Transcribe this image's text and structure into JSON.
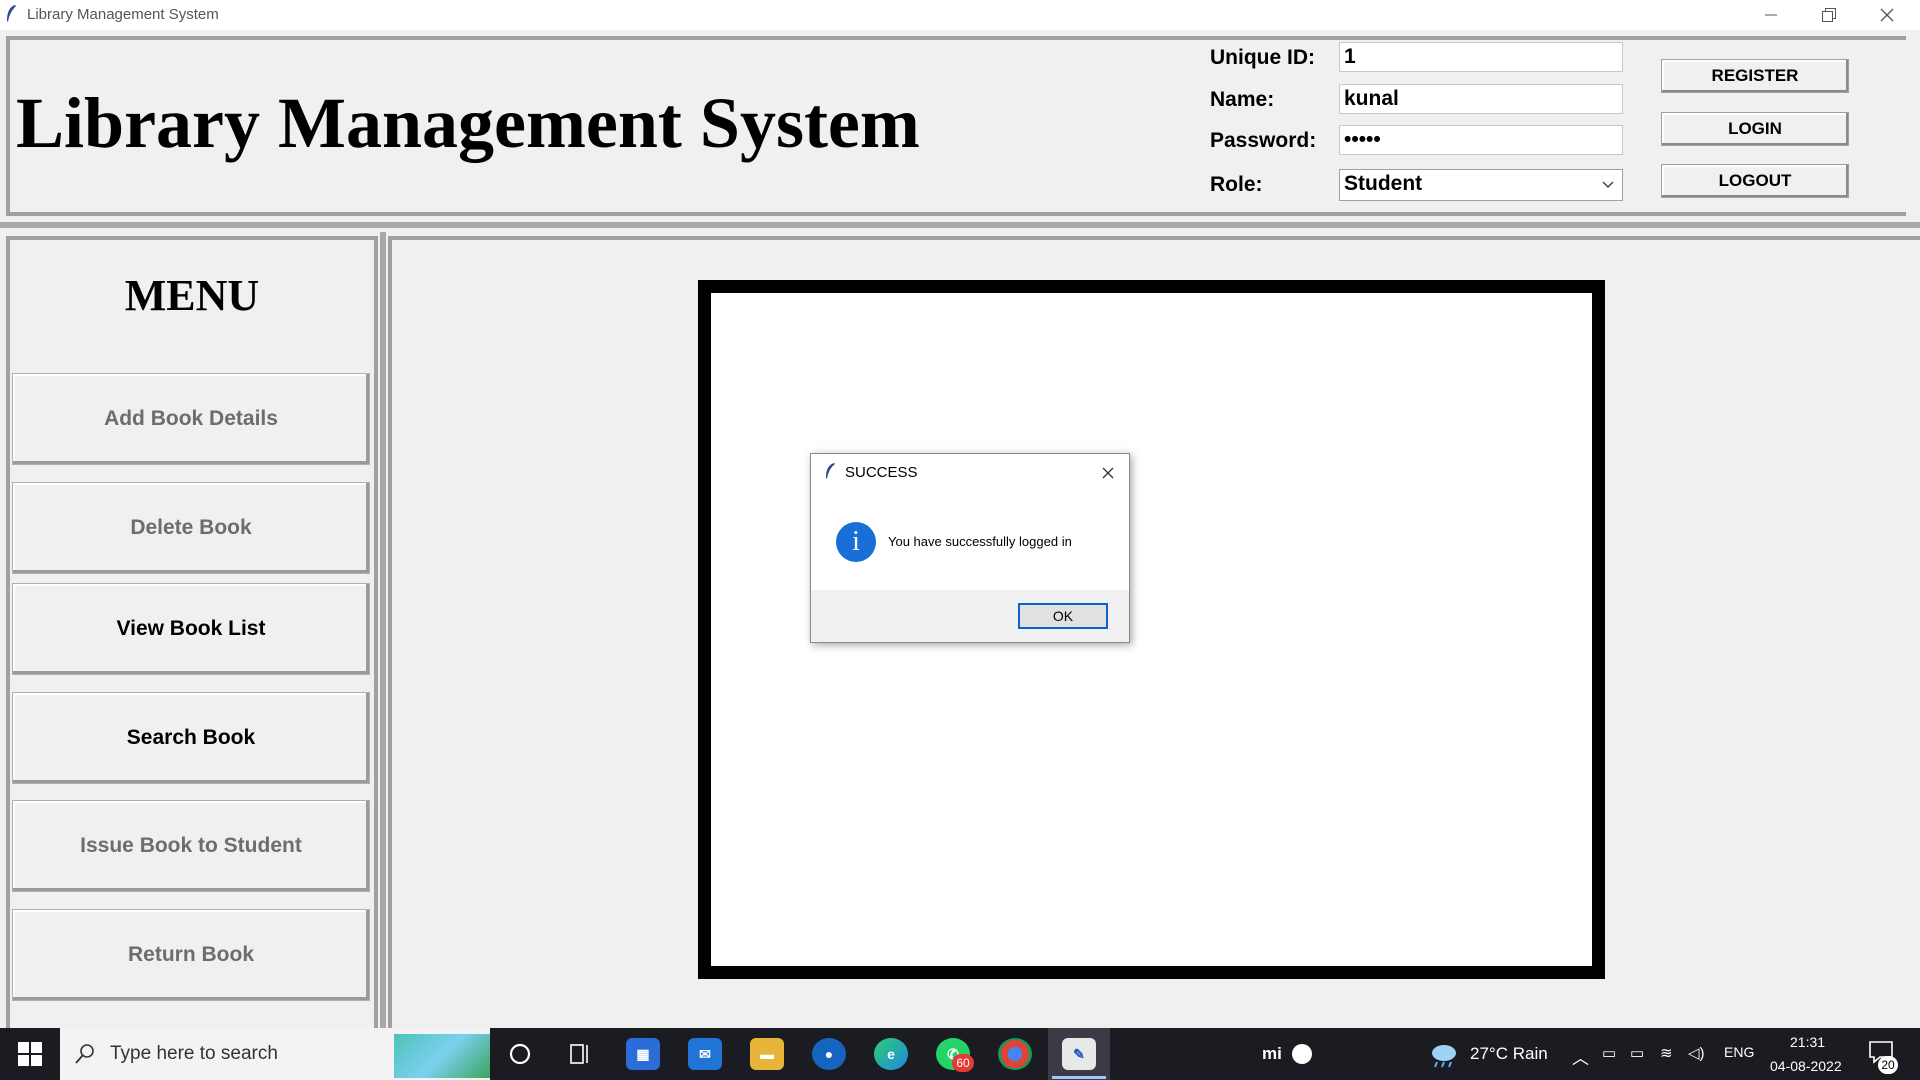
{
  "window": {
    "title": "Library Management System"
  },
  "header": {
    "app_title": "Library Management System",
    "fields": {
      "unique_id": {
        "label": "Unique ID:",
        "value": "1"
      },
      "name": {
        "label": "Name:",
        "value": "kunal"
      },
      "password": {
        "label": "Password:",
        "value": "•••••"
      },
      "role": {
        "label": "Role:",
        "value": "Student"
      }
    },
    "buttons": {
      "register": "REGISTER",
      "login": "LOGIN",
      "logout": "LOGOUT"
    }
  },
  "menu": {
    "title": "MENU",
    "items": [
      {
        "label": "Add Book Details",
        "enabled": false
      },
      {
        "label": "Delete Book",
        "enabled": false
      },
      {
        "label": "View Book List",
        "enabled": true
      },
      {
        "label": "Search Book",
        "enabled": true
      },
      {
        "label": "Issue Book to Student",
        "enabled": false
      },
      {
        "label": "Return Book",
        "enabled": false
      }
    ]
  },
  "dialog": {
    "title": "SUCCESS",
    "message": "You have successfully logged in",
    "ok_label": "OK",
    "icon": "info-icon"
  },
  "taskbar": {
    "search_placeholder": "Type here to search",
    "whatsapp_badge": "60",
    "weather": "27°C  Rain",
    "language": "ENG",
    "time": "21:31",
    "date": "04-08-2022",
    "notification_count": "20",
    "mi_label": "mi"
  },
  "colors": {
    "accent": "#0a64c8",
    "disabled_text": "#6d6d6d",
    "taskbar_bg": "#1b1c22"
  }
}
